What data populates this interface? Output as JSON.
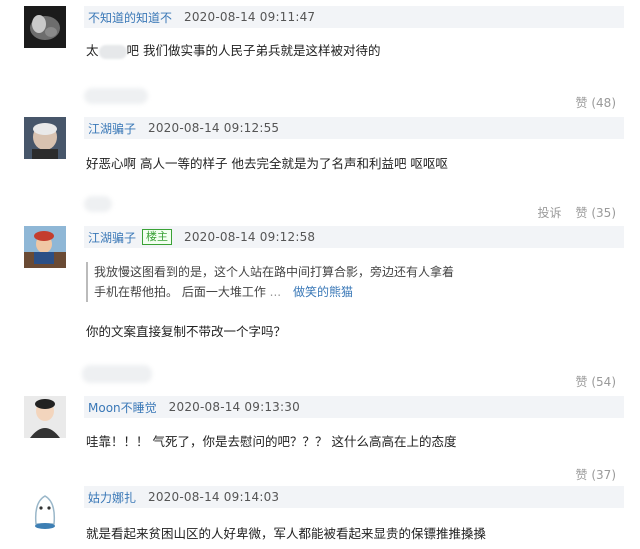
{
  "comments": [
    {
      "user": "不知道的知道不",
      "time": "2020-08-14 09:11:47",
      "text_a": "太",
      "text_b": "吧 我们做实事的人民子弟兵就是这样被对待的",
      "like_label": "赞 (48)"
    },
    {
      "user": "江湖骗子",
      "time": "2020-08-14 09:12:55",
      "text": "好恶心啊 高人一等的样子 他去完全就是为了名声和利益吧 呕呕呕",
      "report_label": "投诉",
      "like_label": "赞 (35)"
    },
    {
      "user": "江湖骗子",
      "badge": "楼主",
      "time": "2020-08-14 09:12:58",
      "quote_line1": "我放慢这图看到的是，这个人站在路中间打算合影，旁边还有人拿着",
      "quote_line2": "手机在帮他拍。 后面一大堆工作",
      "quote_more": "...",
      "quote_author": "做笑的熊猫",
      "text": "你的文案直接复制不带改一个字吗？",
      "like_label": "赞 (54)"
    },
    {
      "user": "Moon不睡觉",
      "time": "2020-08-14 09:13:30",
      "text": "哇靠！！！ 气死了，你是去慰问的吧？？？ 这什么高高在上的态度",
      "like_label": "赞 (37)"
    },
    {
      "user": "姑力娜扎",
      "time": "2020-08-14 09:14:03",
      "text": "就是看起来贫困山区的人好卑微，军人都能被看起来显贵的保镖推推搡搡"
    }
  ]
}
